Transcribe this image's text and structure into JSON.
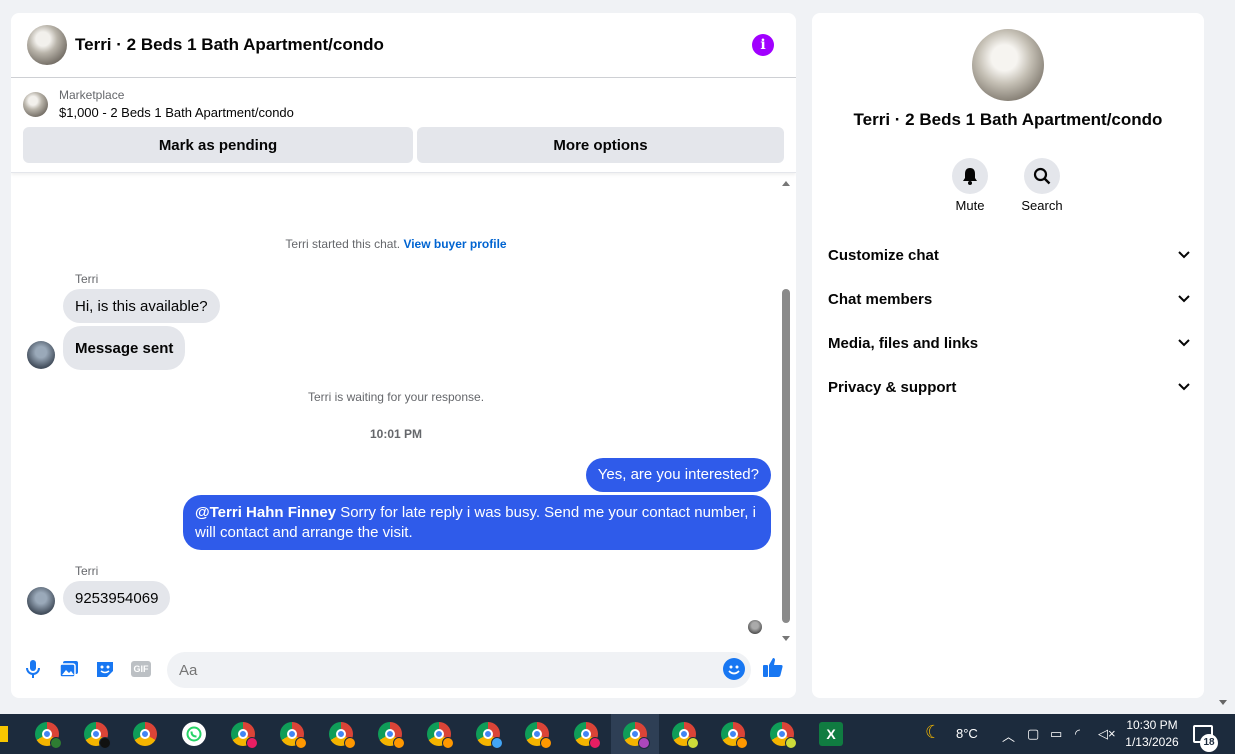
{
  "chat": {
    "title": "Terri · 2 Beds 1 Bath Apartment/condo",
    "listing": {
      "label": "Marketplace",
      "price_title": "$1,000 - 2 Beds 1 Bath Apartment/condo",
      "pending_button": "Mark as pending",
      "options_button": "More options"
    },
    "messages": {
      "started_text": "Terri started this chat. ",
      "view_profile": "View buyer profile",
      "sender1": "Terri",
      "msg1": "Hi, is this available?",
      "msg2": "Message sent",
      "waiting_text": "Terri is waiting for your response.",
      "timestamp": "10:01 PM",
      "out1": "Yes, are you interested?",
      "out2_mention": "@Terri Hahn Finney",
      "out2_text": " Sorry for late reply i was busy. Send me your contact number, i will contact and arrange the visit.",
      "sender2": "Terri",
      "msg3": "9253954069"
    },
    "composer": {
      "placeholder": "Aa",
      "icons": [
        "microphone-icon",
        "photo-icon",
        "sticker-icon",
        "gif-icon",
        "emoji-icon",
        "like-icon"
      ],
      "gif_label": "GIF"
    }
  },
  "sidebar": {
    "title": "Terri · 2 Beds 1 Bath Apartment/condo",
    "mute_label": "Mute",
    "search_label": "Search",
    "sections": [
      "Customize chat",
      "Chat members",
      "Media, files and links",
      "Privacy & support"
    ]
  },
  "taskbar": {
    "weather": "8°C",
    "time": "10:30 PM",
    "date": "1/13/2026",
    "notifications": "18"
  },
  "colors": {
    "accent_blue": "#0064d1",
    "outgoing_bubble": "#2f5bea",
    "info_purple": "#a100ff",
    "messenger_blue": "#1877f2"
  }
}
